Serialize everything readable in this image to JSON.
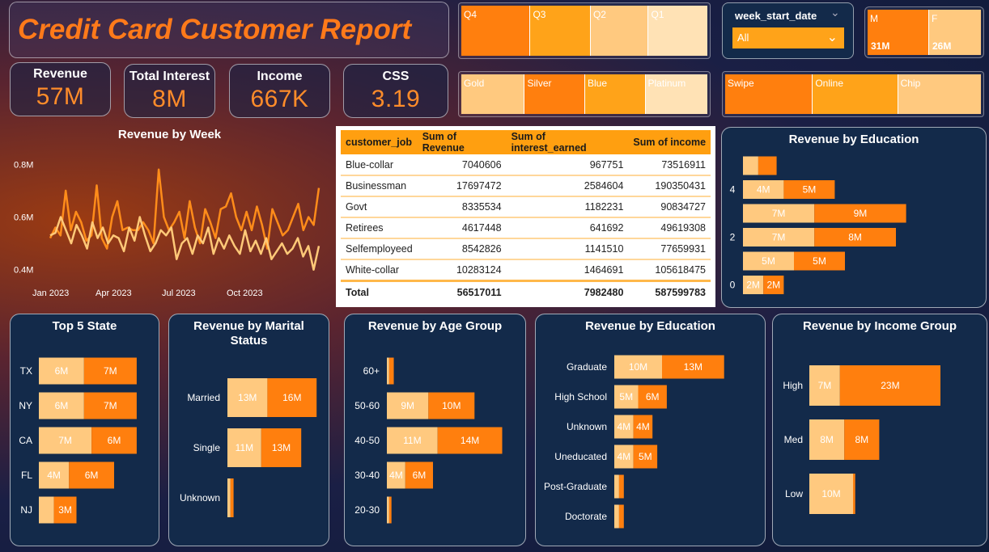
{
  "title": "Credit Card Customer Report",
  "kpis": [
    {
      "label": "Revenue",
      "value": "57M"
    },
    {
      "label": "Total Interest",
      "value": "8M"
    },
    {
      "label": "Income",
      "value": "667K"
    },
    {
      "label": "CSS",
      "value": "3.19"
    }
  ],
  "quarter_slicer": [
    "Q4",
    "Q3",
    "Q2",
    "Q1"
  ],
  "card_slicer": [
    "Gold",
    "Silver",
    "Blue",
    "Platinum"
  ],
  "week_slicer": {
    "label": "week_start_date",
    "value": "All"
  },
  "gender_slicer": [
    {
      "label": "M",
      "value": "31M"
    },
    {
      "label": "F",
      "value": "26M"
    }
  ],
  "txn_slicer": [
    "Swipe",
    "Online",
    "Chip"
  ],
  "colors": {
    "dark": "#ff7f0e",
    "mid": "#ffa319",
    "light": "#ffc97f",
    "pale": "#ffe2b5"
  },
  "table": {
    "headers": [
      "customer_job",
      "Sum of Revenue",
      "Sum of interest_earned",
      "Sum of income"
    ],
    "rows": [
      [
        "Blue-collar",
        "7040606",
        "967751",
        "73516911"
      ],
      [
        "Businessman",
        "17697472",
        "2584604",
        "190350431"
      ],
      [
        "Govt",
        "8335534",
        "1182231",
        "90834727"
      ],
      [
        "Retirees",
        "4617448",
        "641692",
        "49619308"
      ],
      [
        "Selfemployeed",
        "8542826",
        "1141510",
        "77659931"
      ],
      [
        "White-collar",
        "10283124",
        "1464691",
        "105618475"
      ]
    ],
    "total": [
      "Total",
      "56517011",
      "7982480",
      "587599783"
    ]
  },
  "chart_data": [
    {
      "type": "line",
      "title": "Revenue by Week",
      "x_ticks": [
        "Jan 2023",
        "Apr 2023",
        "Jul 2023",
        "Oct 2023"
      ],
      "y_ticks": [
        "0.8M",
        "0.6M",
        "0.4M"
      ],
      "ylim": [
        0.35,
        0.85
      ],
      "series": [
        {
          "color": "#ff8c1a",
          "values": [
            0.52,
            0.56,
            0.53,
            0.7,
            0.55,
            0.62,
            0.58,
            0.51,
            0.53,
            0.72,
            0.52,
            0.48,
            0.6,
            0.66,
            0.55,
            0.56,
            0.55,
            0.55,
            0.58,
            0.55,
            0.5,
            0.78,
            0.6,
            0.55,
            0.58,
            0.62,
            0.52,
            0.66,
            0.56,
            0.5,
            0.63,
            0.58,
            0.52,
            0.63,
            0.64,
            0.69,
            0.6,
            0.55,
            0.62,
            0.55,
            0.64,
            0.57,
            0.48,
            0.63,
            0.58,
            0.53,
            0.55,
            0.6,
            0.65,
            0.55,
            0.6,
            0.57,
            0.71
          ]
        },
        {
          "color": "#ffc978",
          "values": [
            0.53,
            0.54,
            0.6,
            0.55,
            0.5,
            0.57,
            0.53,
            0.48,
            0.58,
            0.52,
            0.56,
            0.5,
            0.53,
            0.52,
            0.47,
            0.56,
            0.51,
            0.6,
            0.53,
            0.47,
            0.5,
            0.55,
            0.53,
            0.56,
            0.44,
            0.5,
            0.52,
            0.46,
            0.53,
            0.5,
            0.56,
            0.46,
            0.52,
            0.48,
            0.53,
            0.49,
            0.46,
            0.55,
            0.47,
            0.51,
            0.46,
            0.52,
            0.44,
            0.47,
            0.5,
            0.46,
            0.48,
            0.52,
            0.45,
            0.49,
            0.4,
            0.49
          ]
        }
      ]
    },
    {
      "type": "bar",
      "title": "Revenue by Education",
      "y_ticks": [
        "4",
        "2",
        "0"
      ],
      "rows": [
        {
          "a": 0.5,
          "b": 0.6,
          "la": "",
          "lb": ""
        },
        {
          "a": 4,
          "b": 5,
          "la": "4M",
          "lb": "5M"
        },
        {
          "a": 7,
          "b": 9,
          "la": "7M",
          "lb": "9M"
        },
        {
          "a": 7,
          "b": 8,
          "la": "7M",
          "lb": "8M"
        },
        {
          "a": 5,
          "b": 5,
          "la": "5M",
          "lb": "5M"
        },
        {
          "a": 2,
          "b": 2,
          "la": "2M",
          "lb": "2M"
        }
      ]
    },
    {
      "type": "bar",
      "title": "Top 5 State",
      "categories": [
        "TX",
        "NY",
        "CA",
        "FL",
        "NJ"
      ],
      "a": [
        6,
        6,
        7,
        4,
        2
      ],
      "b": [
        7,
        7,
        6,
        6,
        3
      ],
      "la": [
        "6M",
        "6M",
        "7M",
        "4M",
        ""
      ],
      "lb": [
        "7M",
        "7M",
        "6M",
        "6M",
        "3M"
      ]
    },
    {
      "type": "bar",
      "title": "Revenue by Marital Status",
      "categories": [
        "Married",
        "Single",
        "Unknown"
      ],
      "a": [
        13,
        11,
        1
      ],
      "b": [
        16,
        13,
        1
      ],
      "la": [
        "13M",
        "11M",
        ""
      ],
      "lb": [
        "16M",
        "13M",
        ""
      ]
    },
    {
      "type": "bar",
      "title": "Revenue by Age Group",
      "categories": [
        "60+",
        "50-60",
        "40-50",
        "30-40",
        "20-30"
      ],
      "a": [
        0.5,
        9,
        11,
        4,
        0.5
      ],
      "b": [
        1,
        10,
        14,
        6,
        0.5
      ],
      "la": [
        "",
        "9M",
        "11M",
        "4M",
        ""
      ],
      "lb": [
        "",
        "10M",
        "14M",
        "6M",
        ""
      ]
    },
    {
      "type": "bar",
      "title": "Revenue by Education",
      "categories": [
        "Graduate",
        "High School",
        "Unknown",
        "Uneducated",
        "Post-Graduate",
        "Doctorate"
      ],
      "a": [
        10,
        5,
        4,
        4,
        1,
        1
      ],
      "b": [
        13,
        6,
        4,
        5,
        1,
        1
      ],
      "la": [
        "10M",
        "5M",
        "4M",
        "4M",
        "",
        ""
      ],
      "lb": [
        "13M",
        "6M",
        "4M",
        "5M",
        "",
        ""
      ]
    },
    {
      "type": "bar",
      "title": "Revenue by Income Group",
      "categories": [
        "High",
        "Med",
        "Low"
      ],
      "a": [
        7,
        8,
        10
      ],
      "b": [
        23,
        8,
        0.5
      ],
      "la": [
        "7M",
        "8M",
        "10M"
      ],
      "lb": [
        "23M",
        "8M",
        ""
      ]
    }
  ]
}
